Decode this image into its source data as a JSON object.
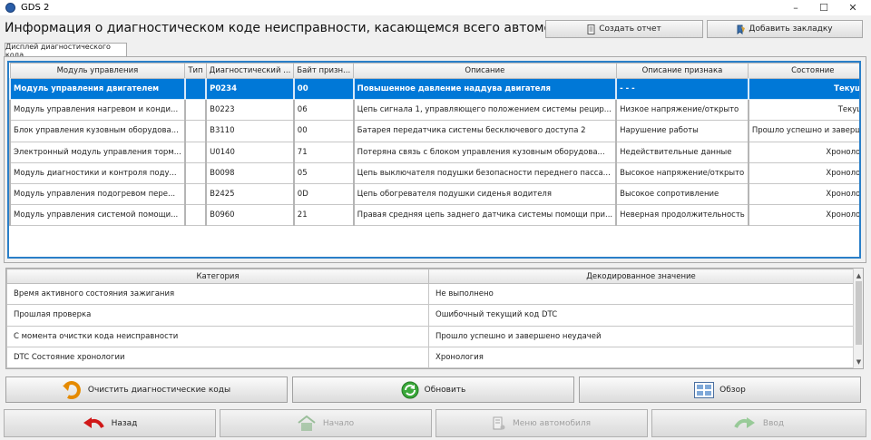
{
  "window": {
    "title": "GDS 2",
    "minimize": "–",
    "maximize": "☐",
    "close": "✕"
  },
  "header": {
    "title": "Информация о диагностическом коде неисправности, касающемся всего автомобиля",
    "create_report": "Создать отчет",
    "add_bookmark": "Добавить закладку"
  },
  "tab": {
    "label": "Дисплей диагностического кода"
  },
  "dtc_table": {
    "columns": [
      "Модуль управления",
      "Тип",
      "Диагностический ...",
      "Байт призн...",
      "Описание",
      "Описание признака",
      "Состояние"
    ],
    "rows": [
      [
        "Модуль управления двигателем",
        "",
        "P0234",
        "00",
        "Повышенное давление наддува двигателя",
        "- - -",
        "Текущий"
      ],
      [
        "Модуль управления нагревом и конди...",
        "",
        "B0223",
        "06",
        "Цепь сигнала 1, управляющего положением системы рецир...",
        "Низкое напряжение/открыто",
        "Текущий"
      ],
      [
        "Блок управления кузовным оборудова...",
        "",
        "B3110",
        "00",
        "Батарея передатчика системы бесключевого доступа 2",
        "Нарушение работы",
        "Прошло успешно и заверше..."
      ],
      [
        "Электронный модуль управления торм...",
        "",
        "U0140",
        "71",
        "Потеряна связь с блоком управления кузовным оборудова...",
        "Недействительные данные",
        "Хронология"
      ],
      [
        "Модуль диагностики и контроля поду...",
        "",
        "B0098",
        "05",
        "Цепь выключателя подушки безопасности переднего пасса...",
        "Высокое напряжение/открыто",
        "Хронология"
      ],
      [
        "Модуль управления подогревом пере...",
        "",
        "B2425",
        "0D",
        "Цепь обогревателя подушки сиденья водителя",
        "Высокое сопротивление",
        "Хронология"
      ],
      [
        "Модуль управления системой помощи...",
        "",
        "B0960",
        "21",
        "Правая средняя цепь заднего датчика системы помощи при...",
        "Неверная продолжительность",
        "Хронология"
      ]
    ]
  },
  "detail_table": {
    "columns": [
      "Категория",
      "Декодированное значение"
    ],
    "rows": [
      [
        "Время активного состояния зажигания",
        "Не выполнено"
      ],
      [
        "Прошлая проверка",
        "Ошибочный текущий код DTC"
      ],
      [
        "С момента очистки кода неисправности",
        "Прошло успешно и завершено неудачей"
      ],
      [
        "DTC Состояние хронологии",
        "Хронология"
      ]
    ]
  },
  "actions": {
    "clear_codes": "Очистить диагностические коды",
    "refresh": "Обновить",
    "overview": "Обзор"
  },
  "nav": {
    "back": "Назад",
    "home": "Начало",
    "vehicle_menu": "Меню автомобиля",
    "forward": "Ввод"
  },
  "colors": {
    "selection": "#0078d7",
    "grid_border": "#2a7fc8"
  }
}
